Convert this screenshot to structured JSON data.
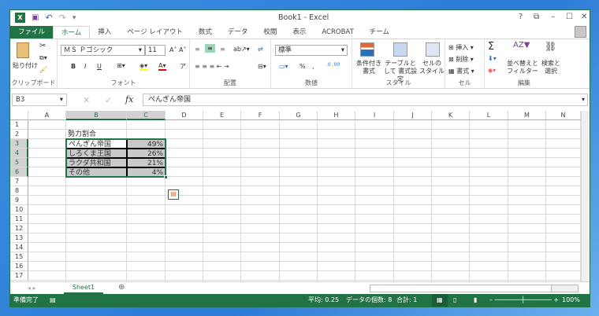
{
  "window": {
    "title": "Book1 - Excel",
    "help": "?",
    "restore": "⧉",
    "minimize": "–",
    "maximize": "☐",
    "close": "✕"
  },
  "qat": {
    "excel": "X",
    "save": "💾",
    "undo": "↶",
    "redo": "↷",
    "more": "▾"
  },
  "tabs": [
    "ファイル",
    "ホーム",
    "挿入",
    "ページ レイアウト",
    "数式",
    "データ",
    "校閲",
    "表示",
    "ACROBAT",
    "チーム"
  ],
  "ribbon": {
    "clipboard": {
      "label": "クリップボード",
      "paste": "貼り付け"
    },
    "font": {
      "label": "フォント",
      "name": "ＭＳ Ｐゴシック",
      "size": "11",
      "bold": "B",
      "italic": "I",
      "underline": "U"
    },
    "alignment": {
      "label": "配置"
    },
    "number": {
      "label": "数値",
      "format": "標準",
      "percent": "%",
      "comma": ","
    },
    "styles": {
      "label": "スタイル",
      "conditional": "条件付き 書式",
      "table": "テーブルとして 書式設定",
      "cell": "セルの スタイル"
    },
    "cells": {
      "label": "セル",
      "insert": "挿入",
      "delete": "削除",
      "format": "書式"
    },
    "editing": {
      "label": "編集",
      "sum": "Σ",
      "sort": "並べ替えと フィルター",
      "find": "検索と 選択"
    }
  },
  "formula_bar": {
    "name_box": "B3",
    "fx": "fx",
    "value": "ぺんぎん帝国"
  },
  "columns": [
    "A",
    "B",
    "C",
    "D",
    "E",
    "F",
    "G",
    "H",
    "I",
    "J",
    "K",
    "L",
    "M",
    "N"
  ],
  "rows": [
    "1",
    "2",
    "3",
    "4",
    "5",
    "6",
    "7",
    "8",
    "9",
    "10",
    "11",
    "12",
    "13",
    "14",
    "15",
    "16",
    "17"
  ],
  "cells": {
    "title": "勢力割合",
    "table": [
      [
        "ぺんぎん帝国",
        "49%"
      ],
      [
        "しろくま王国",
        "26%"
      ],
      [
        "ラクダ共和国",
        "21%"
      ],
      [
        "その他",
        "4%"
      ]
    ]
  },
  "sheets": [
    "Sheet1"
  ],
  "status": {
    "ready": "準備完了",
    "average": "平均: 0.25",
    "count": "データの個数: 8",
    "sum": "合計: 1",
    "zoom": "100%"
  },
  "colors": {
    "accent": "#217346",
    "selection": "#d2d2d2"
  }
}
